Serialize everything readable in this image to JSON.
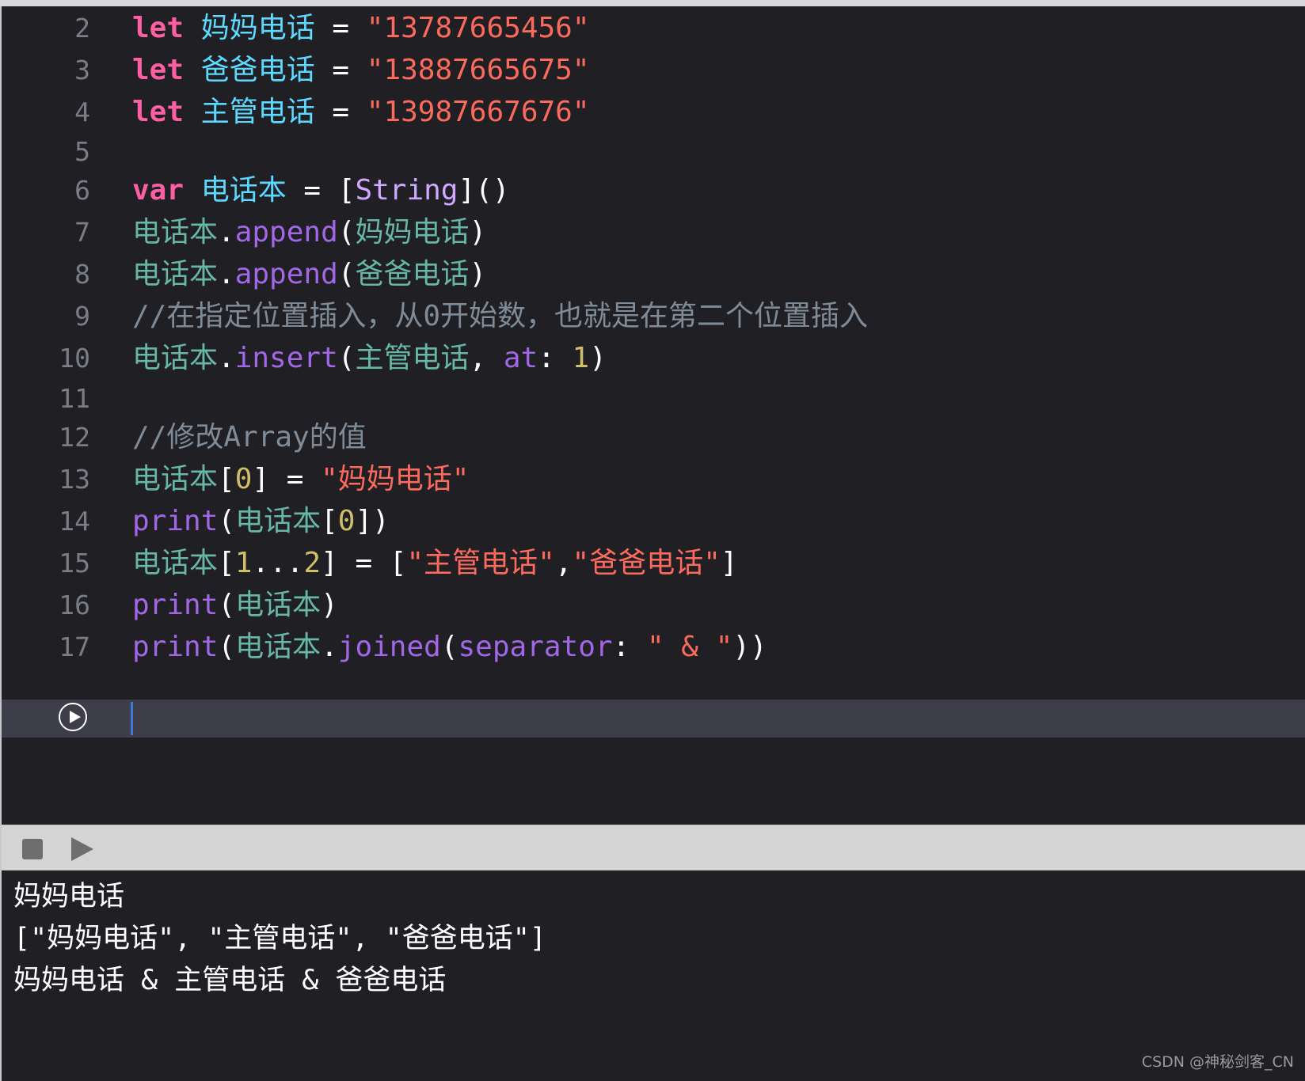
{
  "editor": {
    "lines": [
      {
        "num": "2",
        "tokens": [
          {
            "t": "let",
            "c": "kw"
          },
          {
            "t": " ",
            "c": "pl"
          },
          {
            "t": "妈妈电话",
            "c": "id"
          },
          {
            "t": " = ",
            "c": "pl"
          },
          {
            "t": "\"13787665456\"",
            "c": "str"
          }
        ]
      },
      {
        "num": "3",
        "tokens": [
          {
            "t": "let",
            "c": "kw"
          },
          {
            "t": " ",
            "c": "pl"
          },
          {
            "t": "爸爸电话",
            "c": "id"
          },
          {
            "t": " = ",
            "c": "pl"
          },
          {
            "t": "\"13887665675\"",
            "c": "str"
          }
        ]
      },
      {
        "num": "4",
        "tokens": [
          {
            "t": "let",
            "c": "kw"
          },
          {
            "t": " ",
            "c": "pl"
          },
          {
            "t": "主管电话",
            "c": "id"
          },
          {
            "t": " = ",
            "c": "pl"
          },
          {
            "t": "\"13987667676\"",
            "c": "str"
          }
        ]
      },
      {
        "num": "5",
        "tokens": []
      },
      {
        "num": "6",
        "tokens": [
          {
            "t": "var",
            "c": "kw"
          },
          {
            "t": " ",
            "c": "pl"
          },
          {
            "t": "电话本",
            "c": "id"
          },
          {
            "t": " = [",
            "c": "pl"
          },
          {
            "t": "String",
            "c": "ty"
          },
          {
            "t": "]()",
            "c": "pl"
          }
        ]
      },
      {
        "num": "7",
        "tokens": [
          {
            "t": "电话本",
            "c": "pid"
          },
          {
            "t": ".",
            "c": "pl"
          },
          {
            "t": "append",
            "c": "mth"
          },
          {
            "t": "(",
            "c": "pl"
          },
          {
            "t": "妈妈电话",
            "c": "pid"
          },
          {
            "t": ")",
            "c": "pl"
          }
        ]
      },
      {
        "num": "8",
        "tokens": [
          {
            "t": "电话本",
            "c": "pid"
          },
          {
            "t": ".",
            "c": "pl"
          },
          {
            "t": "append",
            "c": "mth"
          },
          {
            "t": "(",
            "c": "pl"
          },
          {
            "t": "爸爸电话",
            "c": "pid"
          },
          {
            "t": ")",
            "c": "pl"
          }
        ]
      },
      {
        "num": "9",
        "tokens": [
          {
            "t": "//在指定位置插入，从0开始数，也就是在第二个位置插入",
            "c": "cmt"
          }
        ]
      },
      {
        "num": "10",
        "tokens": [
          {
            "t": "电话本",
            "c": "pid"
          },
          {
            "t": ".",
            "c": "pl"
          },
          {
            "t": "insert",
            "c": "mth"
          },
          {
            "t": "(",
            "c": "pl"
          },
          {
            "t": "主管电话",
            "c": "pid"
          },
          {
            "t": ", ",
            "c": "pl"
          },
          {
            "t": "at",
            "c": "mth"
          },
          {
            "t": ": ",
            "c": "pl"
          },
          {
            "t": "1",
            "c": "num"
          },
          {
            "t": ")",
            "c": "pl"
          }
        ]
      },
      {
        "num": "11",
        "tokens": []
      },
      {
        "num": "12",
        "tokens": [
          {
            "t": "//修改Array的值",
            "c": "cmt"
          }
        ]
      },
      {
        "num": "13",
        "tokens": [
          {
            "t": "电话本",
            "c": "pid"
          },
          {
            "t": "[",
            "c": "pl"
          },
          {
            "t": "0",
            "c": "num"
          },
          {
            "t": "] = ",
            "c": "pl"
          },
          {
            "t": "\"妈妈电话\"",
            "c": "str"
          }
        ]
      },
      {
        "num": "14",
        "tokens": [
          {
            "t": "print",
            "c": "mth"
          },
          {
            "t": "(",
            "c": "pl"
          },
          {
            "t": "电话本",
            "c": "pid"
          },
          {
            "t": "[",
            "c": "pl"
          },
          {
            "t": "0",
            "c": "num"
          },
          {
            "t": "])",
            "c": "pl"
          }
        ]
      },
      {
        "num": "15",
        "tokens": [
          {
            "t": "电话本",
            "c": "pid"
          },
          {
            "t": "[",
            "c": "pl"
          },
          {
            "t": "1",
            "c": "num"
          },
          {
            "t": "...",
            "c": "pl"
          },
          {
            "t": "2",
            "c": "num"
          },
          {
            "t": "] = [",
            "c": "pl"
          },
          {
            "t": "\"主管电话\"",
            "c": "str"
          },
          {
            "t": ",",
            "c": "pl"
          },
          {
            "t": "\"爸爸电话\"",
            "c": "str"
          },
          {
            "t": "]",
            "c": "pl"
          }
        ]
      },
      {
        "num": "16",
        "tokens": [
          {
            "t": "print",
            "c": "mth"
          },
          {
            "t": "(",
            "c": "pl"
          },
          {
            "t": "电话本",
            "c": "pid"
          },
          {
            "t": ")",
            "c": "pl"
          }
        ]
      },
      {
        "num": "17",
        "tokens": [
          {
            "t": "print",
            "c": "mth"
          },
          {
            "t": "(",
            "c": "pl"
          },
          {
            "t": "电话本",
            "c": "pid"
          },
          {
            "t": ".",
            "c": "pl"
          },
          {
            "t": "joined",
            "c": "mth"
          },
          {
            "t": "(",
            "c": "pl"
          },
          {
            "t": "separator",
            "c": "mth"
          },
          {
            "t": ": ",
            "c": "pl"
          },
          {
            "t": "\" & \"",
            "c": "str"
          },
          {
            "t": "))",
            "c": "pl"
          }
        ]
      }
    ],
    "run_icon": "play-circle-icon"
  },
  "debug_bar": {
    "stop_icon": "stop-icon",
    "run_icon": "play-icon"
  },
  "console": {
    "output": [
      "妈妈电话",
      "[\"妈妈电话\", \"主管电话\", \"爸爸电话\"]",
      "妈妈电话 & 主管电话 & 爸爸电话"
    ]
  },
  "watermark": "CSDN @神秘剑客_CN",
  "colors": {
    "background": "#1f1f24",
    "keyword": "#fc5fa3",
    "identifier": "#5dd8ff",
    "string": "#fc6a5d",
    "type": "#d0a8ff",
    "project_identifier": "#67b7a4",
    "method": "#a167e6",
    "comment": "#7f8c98",
    "number": "#d0bf69",
    "current_line": "#3d3e4a"
  }
}
